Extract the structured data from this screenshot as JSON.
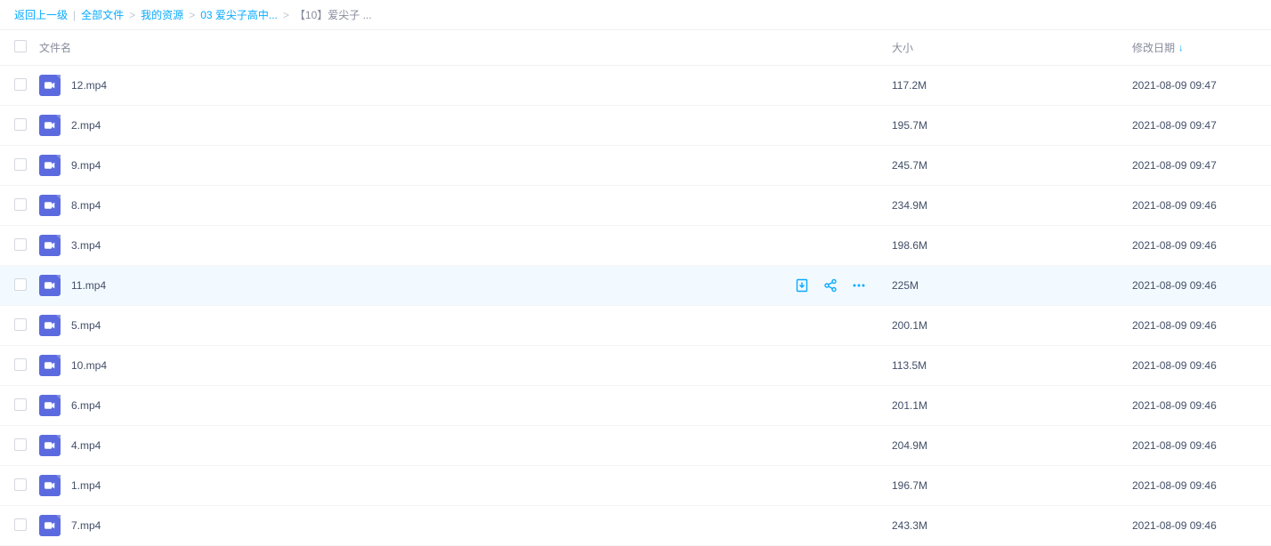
{
  "breadcrumb": {
    "back": "返回上一级",
    "items": [
      "全部文件",
      "我的资源",
      "03 爱尖子高中...",
      "【10】爱尖子 ..."
    ]
  },
  "columns": {
    "name": "文件名",
    "size": "大小",
    "date": "修改日期"
  },
  "files": [
    {
      "name": "12.mp4",
      "size": "117.2M",
      "date": "2021-08-09 09:47",
      "hovered": false
    },
    {
      "name": "2.mp4",
      "size": "195.7M",
      "date": "2021-08-09 09:47",
      "hovered": false
    },
    {
      "name": "9.mp4",
      "size": "245.7M",
      "date": "2021-08-09 09:47",
      "hovered": false
    },
    {
      "name": "8.mp4",
      "size": "234.9M",
      "date": "2021-08-09 09:46",
      "hovered": false
    },
    {
      "name": "3.mp4",
      "size": "198.6M",
      "date": "2021-08-09 09:46",
      "hovered": false
    },
    {
      "name": "11.mp4",
      "size": "225M",
      "date": "2021-08-09 09:46",
      "hovered": true
    },
    {
      "name": "5.mp4",
      "size": "200.1M",
      "date": "2021-08-09 09:46",
      "hovered": false
    },
    {
      "name": "10.mp4",
      "size": "113.5M",
      "date": "2021-08-09 09:46",
      "hovered": false
    },
    {
      "name": "6.mp4",
      "size": "201.1M",
      "date": "2021-08-09 09:46",
      "hovered": false
    },
    {
      "name": "4.mp4",
      "size": "204.9M",
      "date": "2021-08-09 09:46",
      "hovered": false
    },
    {
      "name": "1.mp4",
      "size": "196.7M",
      "date": "2021-08-09 09:46",
      "hovered": false
    },
    {
      "name": "7.mp4",
      "size": "243.3M",
      "date": "2021-08-09 09:46",
      "hovered": false
    }
  ]
}
